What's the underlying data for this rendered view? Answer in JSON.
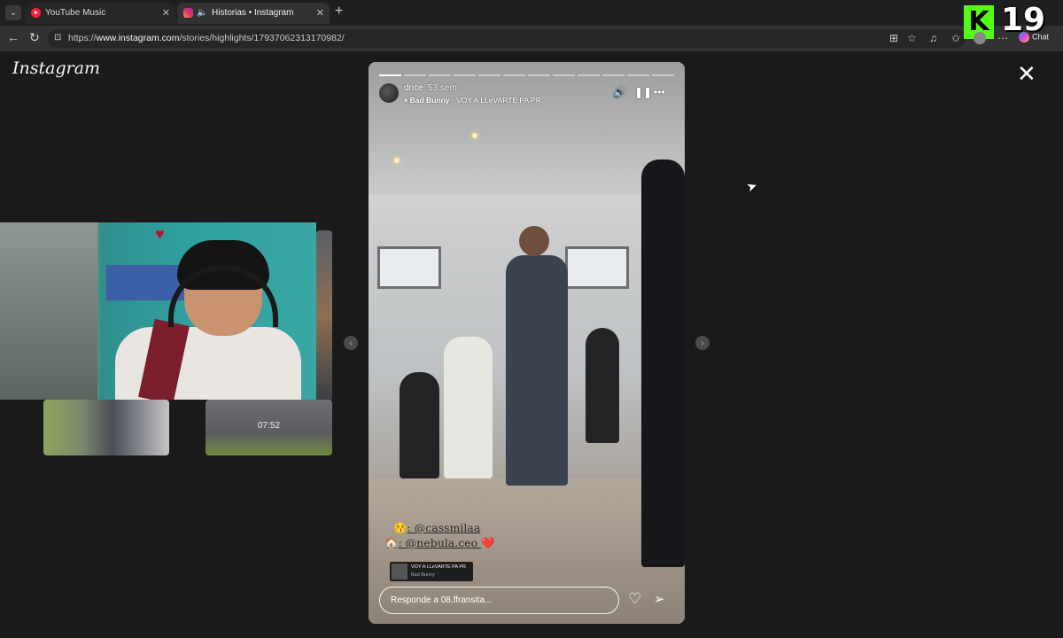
{
  "browser": {
    "tabs": [
      {
        "title": "YouTube Music",
        "active": false
      },
      {
        "title": "Historias • Instagram",
        "active": true
      }
    ],
    "url_prefix": "https://",
    "url_domain": "www.instagram.com",
    "url_path": "/stories/highlights/17937062313170982/",
    "chat_label": "Chat"
  },
  "stream_overlay": {
    "logo_letter": "K",
    "number": "19"
  },
  "viewer": {
    "logo": "Instagram",
    "thumbnail_time": "07:52"
  },
  "story": {
    "username": "dnce",
    "time_ago": "53 sem",
    "music_artist": "Bad Bunny",
    "music_title": "VOY A LLeVARTE PA PR",
    "mentions": [
      {
        "emoji": "😚",
        "handle": "@cassmilaa",
        "suffix": ""
      },
      {
        "emoji": "🏠",
        "handle": "@nebula.ceo",
        "suffix": "❤️"
      }
    ],
    "sticker_title": "VOY A LLeVARTE PA PR",
    "sticker_artist": "Bad Bunny",
    "reply_placeholder": "Responde a 08.ffransita...",
    "progress_segments": 12,
    "progress_active": 1
  },
  "colors": {
    "kick_green": "#53fc18",
    "background": "#1a1a1a"
  }
}
